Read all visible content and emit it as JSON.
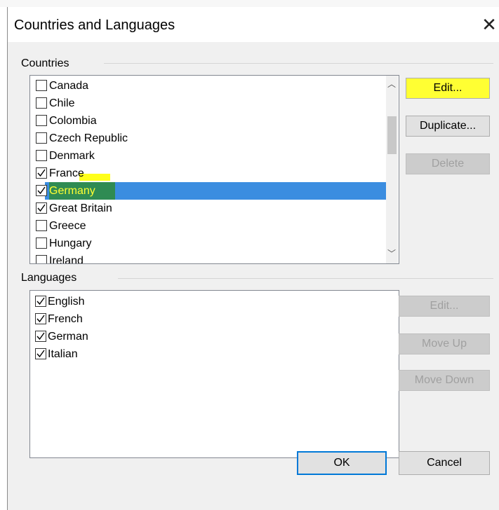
{
  "dialog": {
    "title": "Countries and Languages",
    "close_glyph": "✕"
  },
  "countries": {
    "label": "Countries",
    "items": [
      {
        "label": "Canada",
        "checked": false
      },
      {
        "label": "Chile",
        "checked": false
      },
      {
        "label": "Colombia",
        "checked": false
      },
      {
        "label": "Czech Republic",
        "checked": false
      },
      {
        "label": "Denmark",
        "checked": false
      },
      {
        "label": "France",
        "checked": true
      },
      {
        "label": "Germany",
        "checked": true,
        "selected": true
      },
      {
        "label": "Great Britain",
        "checked": true
      },
      {
        "label": "Greece",
        "checked": false
      },
      {
        "label": "Hungary",
        "checked": false
      },
      {
        "label": "Ireland",
        "checked": false
      }
    ],
    "buttons": {
      "edit": "Edit...",
      "duplicate": "Duplicate...",
      "delete": "Delete"
    }
  },
  "languages": {
    "label": "Languages",
    "items": [
      {
        "label": "English",
        "checked": true
      },
      {
        "label": "French",
        "checked": true
      },
      {
        "label": "German",
        "checked": true
      },
      {
        "label": "Italian",
        "checked": true
      }
    ],
    "buttons": {
      "edit": "Edit...",
      "move_up": "Move Up",
      "move_down": "Move Down"
    }
  },
  "footer": {
    "ok": "OK",
    "cancel": "Cancel"
  },
  "colors": {
    "selection": "#3b8de0",
    "highlight": "#ffff1a",
    "default_border": "#0078d7"
  }
}
